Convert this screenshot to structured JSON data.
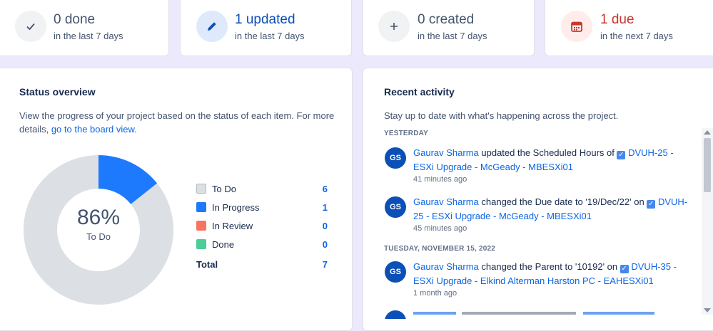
{
  "stats": [
    {
      "value": "0 done",
      "period": "in the last 7 days",
      "icon": "check-icon",
      "accent": "#44546f",
      "bg": "#f1f2f4"
    },
    {
      "value": "1 updated",
      "period": "in the last 7 days",
      "icon": "pencil-icon",
      "accent": "#0c4fb6",
      "bg": "#dee9fc"
    },
    {
      "value": "0 created",
      "period": "in the last 7 days",
      "icon": "plus-icon",
      "accent": "#44546f",
      "bg": "#f1f2f4"
    },
    {
      "value": "1 due",
      "period": "in the next 7 days",
      "icon": "calendar-icon",
      "accent": "#c9372c",
      "bg": "#ffeceb"
    }
  ],
  "status_overview": {
    "title": "Status overview",
    "description": "View the progress of your project based on the status of each item. For more details,",
    "link_text": "go to the board view.",
    "center_percent": "86%",
    "center_label": "To Do",
    "legend": [
      {
        "label": "To Do",
        "count": "6",
        "color": "#dcdfe4"
      },
      {
        "label": "In Progress",
        "count": "1",
        "color": "#1d7afc"
      },
      {
        "label": "In Review",
        "count": "0",
        "color": "#f87462"
      },
      {
        "label": "Done",
        "count": "0",
        "color": "#4bce97"
      }
    ],
    "total_label": "Total",
    "total_count": "7"
  },
  "chart_data": {
    "type": "pie",
    "categories": [
      "To Do",
      "In Progress",
      "In Review",
      "Done"
    ],
    "values": [
      6,
      1,
      0,
      0
    ],
    "colors": [
      "#dcdfe4",
      "#1d7afc",
      "#f87462",
      "#4bce97"
    ],
    "title": ""
  },
  "recent_activity": {
    "title": "Recent activity",
    "description": "Stay up to date with what's happening across the project.",
    "groups": [
      {
        "day": "YESTERDAY",
        "items": [
          {
            "initials": "GS",
            "user": "Gaurav Sharma",
            "action": "updated the Scheduled Hours of",
            "link_a": "DVUH-25 -",
            "link_b": "ESXi Upgrade - McGeady - MBESXi01",
            "time": "41 minutes ago"
          },
          {
            "initials": "GS",
            "user": "Gaurav Sharma",
            "action": "changed the Due date to '19/Dec/22' on",
            "link_a": "DVUH-",
            "link_b": "25 - ESXi Upgrade - McGeady - MBESXi01",
            "time": "45 minutes ago"
          }
        ]
      },
      {
        "day": "TUESDAY, NOVEMBER 15, 2022",
        "items": [
          {
            "initials": "GS",
            "user": "Gaurav Sharma",
            "action": "changed the Parent to '10192' on",
            "link_a": "DVUH-35 -",
            "link_b": "ESXi Upgrade - Elkind Alterman Harston PC - EAHESXi01",
            "time": "1 month ago"
          }
        ]
      }
    ]
  }
}
